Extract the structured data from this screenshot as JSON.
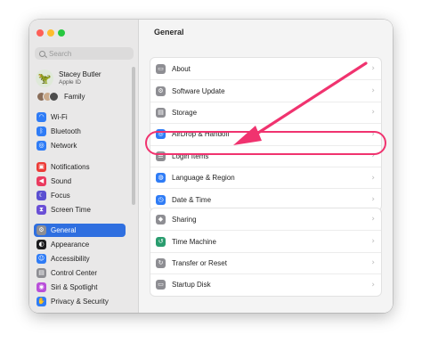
{
  "window": {
    "traffic_lights": [
      "#fe5f57",
      "#febc2e",
      "#28c840"
    ]
  },
  "sidebar": {
    "search": {
      "placeholder": "Search",
      "value": ""
    },
    "account": {
      "name": "Stacey Butler",
      "subtitle": "Apple ID",
      "avatar_icon": "dinosaur-emoji"
    },
    "family": {
      "label": "Family"
    },
    "items": [
      {
        "label": "Wi-Fi",
        "icon": "wifi-icon",
        "color": "#2f7cf6",
        "glyph": "◠"
      },
      {
        "label": "Bluetooth",
        "icon": "bluetooth-icon",
        "color": "#2f7cf6",
        "glyph": "ᛒ"
      },
      {
        "label": "Network",
        "icon": "network-icon",
        "color": "#2f7cf6",
        "glyph": "◎"
      },
      {
        "label": "Notifications",
        "icon": "notifications-icon",
        "color": "#ec3b36",
        "glyph": "▣"
      },
      {
        "label": "Sound",
        "icon": "sound-icon",
        "color": "#ea3b5f",
        "glyph": "◀"
      },
      {
        "label": "Focus",
        "icon": "focus-icon",
        "color": "#5a4fd1",
        "glyph": "☾"
      },
      {
        "label": "Screen Time",
        "icon": "screen-time-icon",
        "color": "#6a4fd6",
        "glyph": "⧗"
      },
      {
        "label": "General",
        "icon": "general-gear-icon",
        "color": "#8e8e93",
        "glyph": "⚙",
        "selected": true
      },
      {
        "label": "Appearance",
        "icon": "appearance-icon",
        "color": "#1c1c1e",
        "glyph": "◐"
      },
      {
        "label": "Accessibility",
        "icon": "accessibility-icon",
        "color": "#2f7cf6",
        "glyph": "☺"
      },
      {
        "label": "Control Center",
        "icon": "control-center-icon",
        "color": "#8e8e93",
        "glyph": "▤"
      },
      {
        "label": "Siri & Spotlight",
        "icon": "siri-icon",
        "color": "#b94fd9",
        "glyph": "◉"
      },
      {
        "label": "Privacy & Security",
        "icon": "privacy-hand-icon",
        "color": "#2f7cf6",
        "glyph": "✋"
      }
    ]
  },
  "content": {
    "title": "General",
    "groups": [
      [
        {
          "label": "About",
          "icon": "about-icon",
          "color": "#8e8e93",
          "glyph": "▭"
        },
        {
          "label": "Software Update",
          "icon": "software-update-gear-icon",
          "color": "#8e8e93",
          "glyph": "⚙"
        },
        {
          "label": "Storage",
          "icon": "storage-icon",
          "color": "#8e8e93",
          "glyph": "▤"
        },
        {
          "label": "AirDrop & Handoff",
          "icon": "airdrop-icon",
          "color": "#2f7cf6",
          "glyph": "◎"
        },
        {
          "label": "Login Items",
          "icon": "login-items-icon",
          "color": "#8e8e93",
          "glyph": "☰"
        },
        {
          "label": "Language & Region",
          "icon": "language-globe-icon",
          "color": "#2f7cf6",
          "glyph": "◍"
        },
        {
          "label": "Date & Time",
          "icon": "date-time-icon",
          "color": "#2f7cf6",
          "glyph": "◷"
        }
      ],
      [
        {
          "label": "Sharing",
          "icon": "sharing-icon",
          "color": "#8e8e93",
          "glyph": "◆"
        },
        {
          "label": "Time Machine",
          "icon": "time-machine-icon",
          "color": "#2a9d6f",
          "glyph": "↺"
        },
        {
          "label": "Transfer or Reset",
          "icon": "transfer-reset-icon",
          "color": "#8e8e93",
          "glyph": "↻"
        },
        {
          "label": "Startup Disk",
          "icon": "startup-disk-icon",
          "color": "#8e8e93",
          "glyph": "▭"
        }
      ]
    ],
    "chevron": "›"
  },
  "annotation": {
    "color": "#f0336f",
    "target": "Login Items"
  }
}
